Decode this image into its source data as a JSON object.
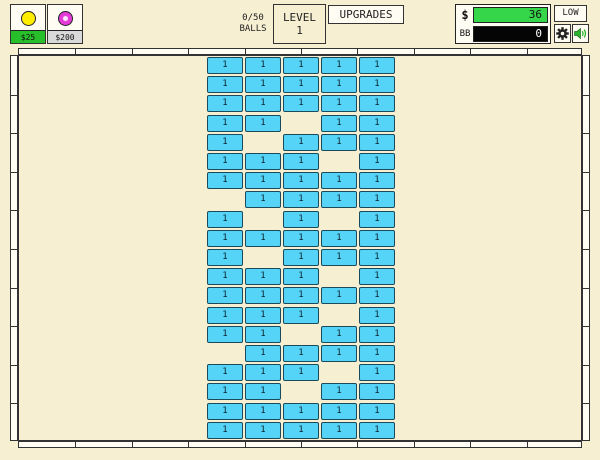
{
  "shop": [
    {
      "id": "basic",
      "price": "$25",
      "color": "#ffee00"
    },
    {
      "id": "plasma",
      "price": "$200",
      "color": "#e43bd8"
    }
  ],
  "balls": {
    "line1": "0/50",
    "line2": "BALLS"
  },
  "level": {
    "label": "LEVEL",
    "value": "1"
  },
  "upgrades_label": "UPGRADES",
  "money": {
    "symbol": "$",
    "cash": "36",
    "bb_label": "BB",
    "bb_value": "0"
  },
  "quality_label": "LOW",
  "colors": {
    "brick": "#55d4f8",
    "cash_bar": "#35d64a",
    "background": "#f7efd2"
  },
  "icons": [
    "gear-icon",
    "speaker-icon"
  ],
  "brick_health": "1",
  "brick_grid": {
    "columns": 5,
    "rows": [
      "11111",
      "11111",
      "11111",
      "11.11",
      "1.111",
      "111.1",
      "11111",
      ".1111",
      "1.1.1",
      "11111",
      "1.111",
      "111.1",
      "11111",
      "111.1",
      "11.11",
      ".1111",
      "111.1",
      "11.11",
      "11111",
      "11111"
    ]
  }
}
